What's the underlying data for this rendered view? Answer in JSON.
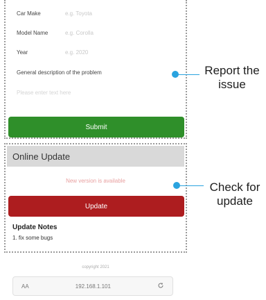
{
  "form": {
    "car_make": {
      "label": "Car Make",
      "placeholder": "e.g. Toyota"
    },
    "model_name": {
      "label": "Model Name",
      "placeholder": "e.g. Corolla"
    },
    "year": {
      "label": "Year",
      "placeholder": "e.g. 2020"
    },
    "description": {
      "label": "General description of the problem",
      "placeholder": "Please enter text here"
    },
    "submit_label": "Submit"
  },
  "online_update": {
    "title": "Online Update",
    "status": "New version is available",
    "update_label": "Update",
    "notes_title": "Update Notes",
    "notes_body": "1. fix some bugs"
  },
  "annotations": {
    "report": "Report the issue",
    "check_update": "Check for update"
  },
  "footer": {
    "copyright": "copyright 2021",
    "aa": "AA",
    "address": "192.168.1.101",
    "reload_icon": "reload-icon"
  },
  "colors": {
    "submit": "#2f8f2a",
    "update": "#ad1d1f",
    "annotation": "#2aa3df"
  }
}
